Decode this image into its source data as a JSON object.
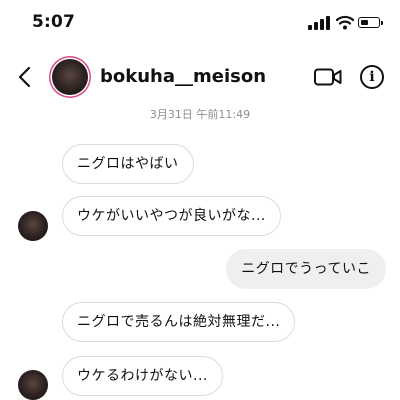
{
  "status_bar": {
    "time": "5:07",
    "battery_level": 0.45
  },
  "header": {
    "username": "bokuha__meison"
  },
  "conversation": {
    "date_label": "3月31日 午前11:49",
    "messages": [
      {
        "text": "ニグロはやばい",
        "direction": "incoming"
      },
      {
        "text": "ウケがいいやつが良いがな...",
        "direction": "incoming"
      },
      {
        "text": "ニグロでうっていこ",
        "direction": "outgoing"
      },
      {
        "text": "ニグロで売るんは絶対無理だ...",
        "direction": "incoming"
      },
      {
        "text": "ウケるわけがない...",
        "direction": "incoming"
      }
    ]
  },
  "icons": [
    "back-arrow-icon",
    "video-call-icon",
    "info-icon",
    "signal-icon",
    "wifi-icon",
    "battery-icon"
  ]
}
